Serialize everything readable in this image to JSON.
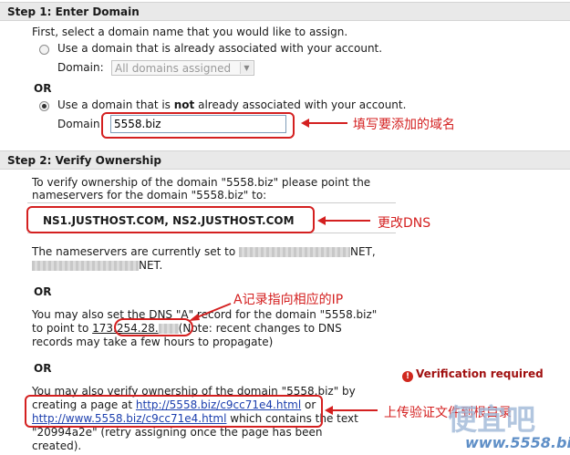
{
  "step1": {
    "header": "Step 1: Enter Domain",
    "intro": "First, select a domain name that you would like to assign.",
    "option1_label": "Use a domain that is already associated with your account.",
    "domain_label": "Domain:",
    "select_value": "All domains assigned",
    "or_label": "OR",
    "option2_prefix": "Use a domain that is ",
    "option2_bold": "not",
    "option2_suffix": " already associated with your account.",
    "input_value": "5558.biz",
    "annotation": "填写要添加的域名"
  },
  "step2": {
    "header": "Step 2: Verify Ownership",
    "intro_line1": "To verify ownership of the domain \"5558.biz\" please point the",
    "intro_line2": "nameservers for the domain \"5558.biz\" to:",
    "nameservers": "NS1.JUSTHOST.COM, NS2.JUSTHOST.COM",
    "ns_annotation": "更改DNS",
    "current_prefix": "The nameservers are currently set to ",
    "current_suffix1": "NET,",
    "current_suffix2": "NET.",
    "or1": "OR",
    "dns_line1": "You may also set the DNS \"A\" record for the domain \"5558.biz\"",
    "dns_line2_prefix": "to point to ",
    "dns_ip": "173.254.28.",
    "dns_line2_suffix": "(Note: recent changes to DNS",
    "dns_line3": "records may take a few hours to propagate)",
    "a_annotation": "A记录指向相应的IP",
    "or2": "OR",
    "page_line1": "You may also verify ownership of the domain \"5558.biz\" by",
    "page_line2_prefix": "creating a page at ",
    "page_link1": "http://5558.biz/c9cc71e4.html",
    "page_line2_suffix": " or",
    "page_link2": "http://www.5558.biz/c9cc71e4.html",
    "page_line3_suffix": " which contains the text",
    "page_line4": "\"20994a2e\" (retry assigning once the page has been",
    "page_line5": "created).",
    "verification": "Verification required",
    "upload_annotation": "上传验证文件到根目录"
  },
  "watermark": {
    "logo_text": "便宜吧",
    "url": "www.5558.biz"
  },
  "colors": {
    "annotation": "#d42020",
    "link": "#1c3fae",
    "header_bg": "#e9e9e9"
  }
}
